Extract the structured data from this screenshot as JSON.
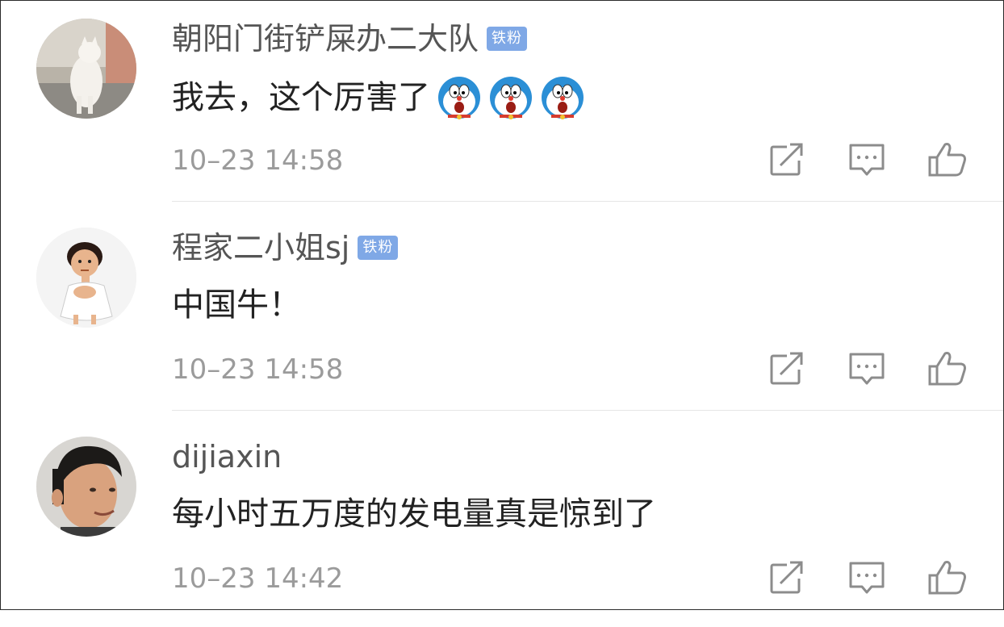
{
  "comments": [
    {
      "username": "朝阳门街铲屎办二大队",
      "badge": "铁粉",
      "content": "我去，这个厉害了",
      "emojis": [
        "doraemon-surprised-icon",
        "doraemon-surprised-icon",
        "doraemon-surprised-icon"
      ],
      "timestamp": "10–23 14:58",
      "avatar": "cat-avatar"
    },
    {
      "username": "程家二小姐sj",
      "badge": "铁粉",
      "content": "中国牛！",
      "emojis": [],
      "timestamp": "10–23 14:58",
      "avatar": "cartoon-avatar"
    },
    {
      "username": "dijiaxin",
      "badge": "",
      "content": "每小时五万度的发电量真是惊到了",
      "emojis": [],
      "timestamp": "10–23 14:42",
      "avatar": "person-avatar"
    }
  ],
  "actions": [
    "share-icon",
    "reply-icon",
    "like-icon"
  ],
  "colors": {
    "badge": "#7fa8e6",
    "username": "#555555",
    "content": "#222222",
    "timestamp": "#9b9b9b",
    "icon": "#8c8c8c",
    "divider": "#e6e6e6"
  }
}
